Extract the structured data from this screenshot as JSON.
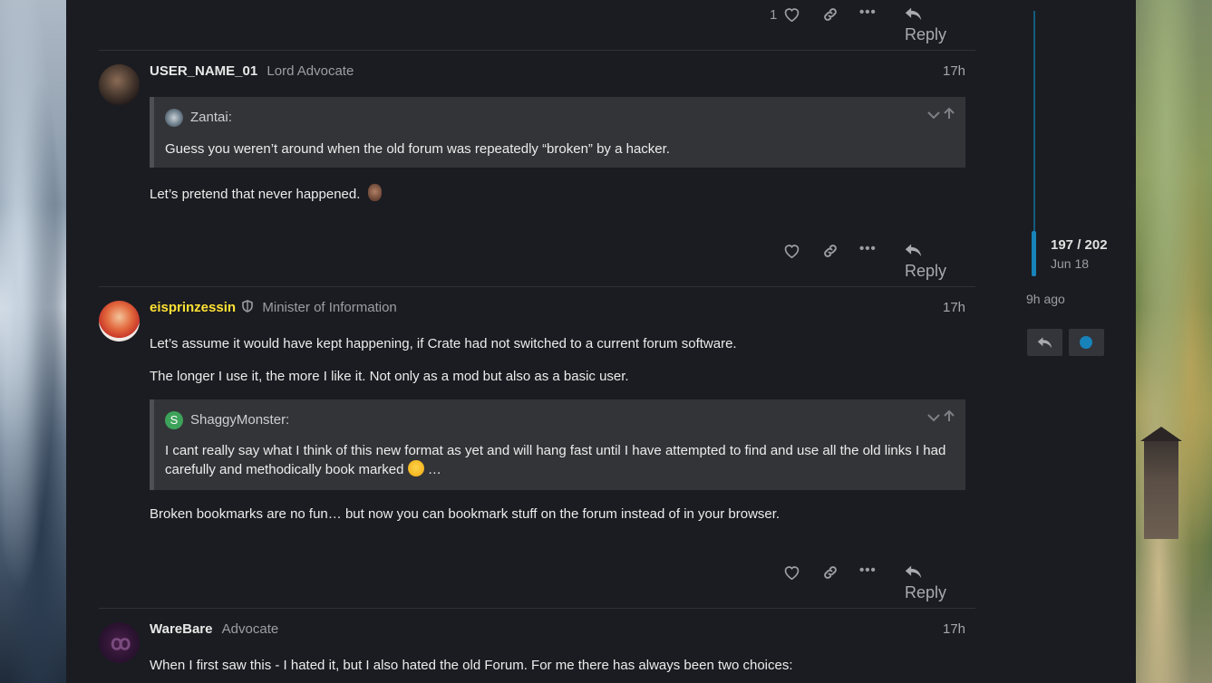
{
  "top_actions": {
    "like_count": "1",
    "reply_label": "Reply"
  },
  "posts": [
    {
      "username": "USER_NAME_01",
      "title": "Lord Advocate",
      "time": "17h",
      "quote": {
        "author": "Zantai:",
        "text": "Guess you weren’t around when the old forum was repeatedly “broken” by a hacker."
      },
      "paragraphs": [
        "Let’s pretend that never happened."
      ],
      "reply_label": "Reply"
    },
    {
      "username": "eisprinzessin",
      "title": "Minister of Information",
      "time": "17h",
      "paragraphs": [
        "Let’s assume it would have kept happening, if Crate had not switched to a current forum software.",
        "The longer I use it, the more I like it. Not only as a mod but also as a basic user.",
        "Broken bookmarks are no fun… but now you can bookmark stuff on the forum instead of in your browser."
      ],
      "quote": {
        "author": "ShaggyMonster:",
        "avatar_letter": "S",
        "line1": "I cant really say what I think of this new format as yet and will hang fast until I have attempted to find and use all the old links I had",
        "line2": "carefully and methodically book marked",
        "line2_suffix": "…"
      },
      "reply_label": "Reply"
    },
    {
      "username": "WareBare",
      "title": "Advocate",
      "time": "17h",
      "paragraphs": [
        "When I first saw this - I hated it, but I also hated the old Forum. For me there has always been two choices:"
      ]
    }
  ],
  "timeline": {
    "position": "197 / 202",
    "date": "Jun 18",
    "ago": "9h ago"
  },
  "colors": {
    "accent": "#1783ba",
    "moderator_name": "#ffe135",
    "background": "#1b1c21"
  }
}
